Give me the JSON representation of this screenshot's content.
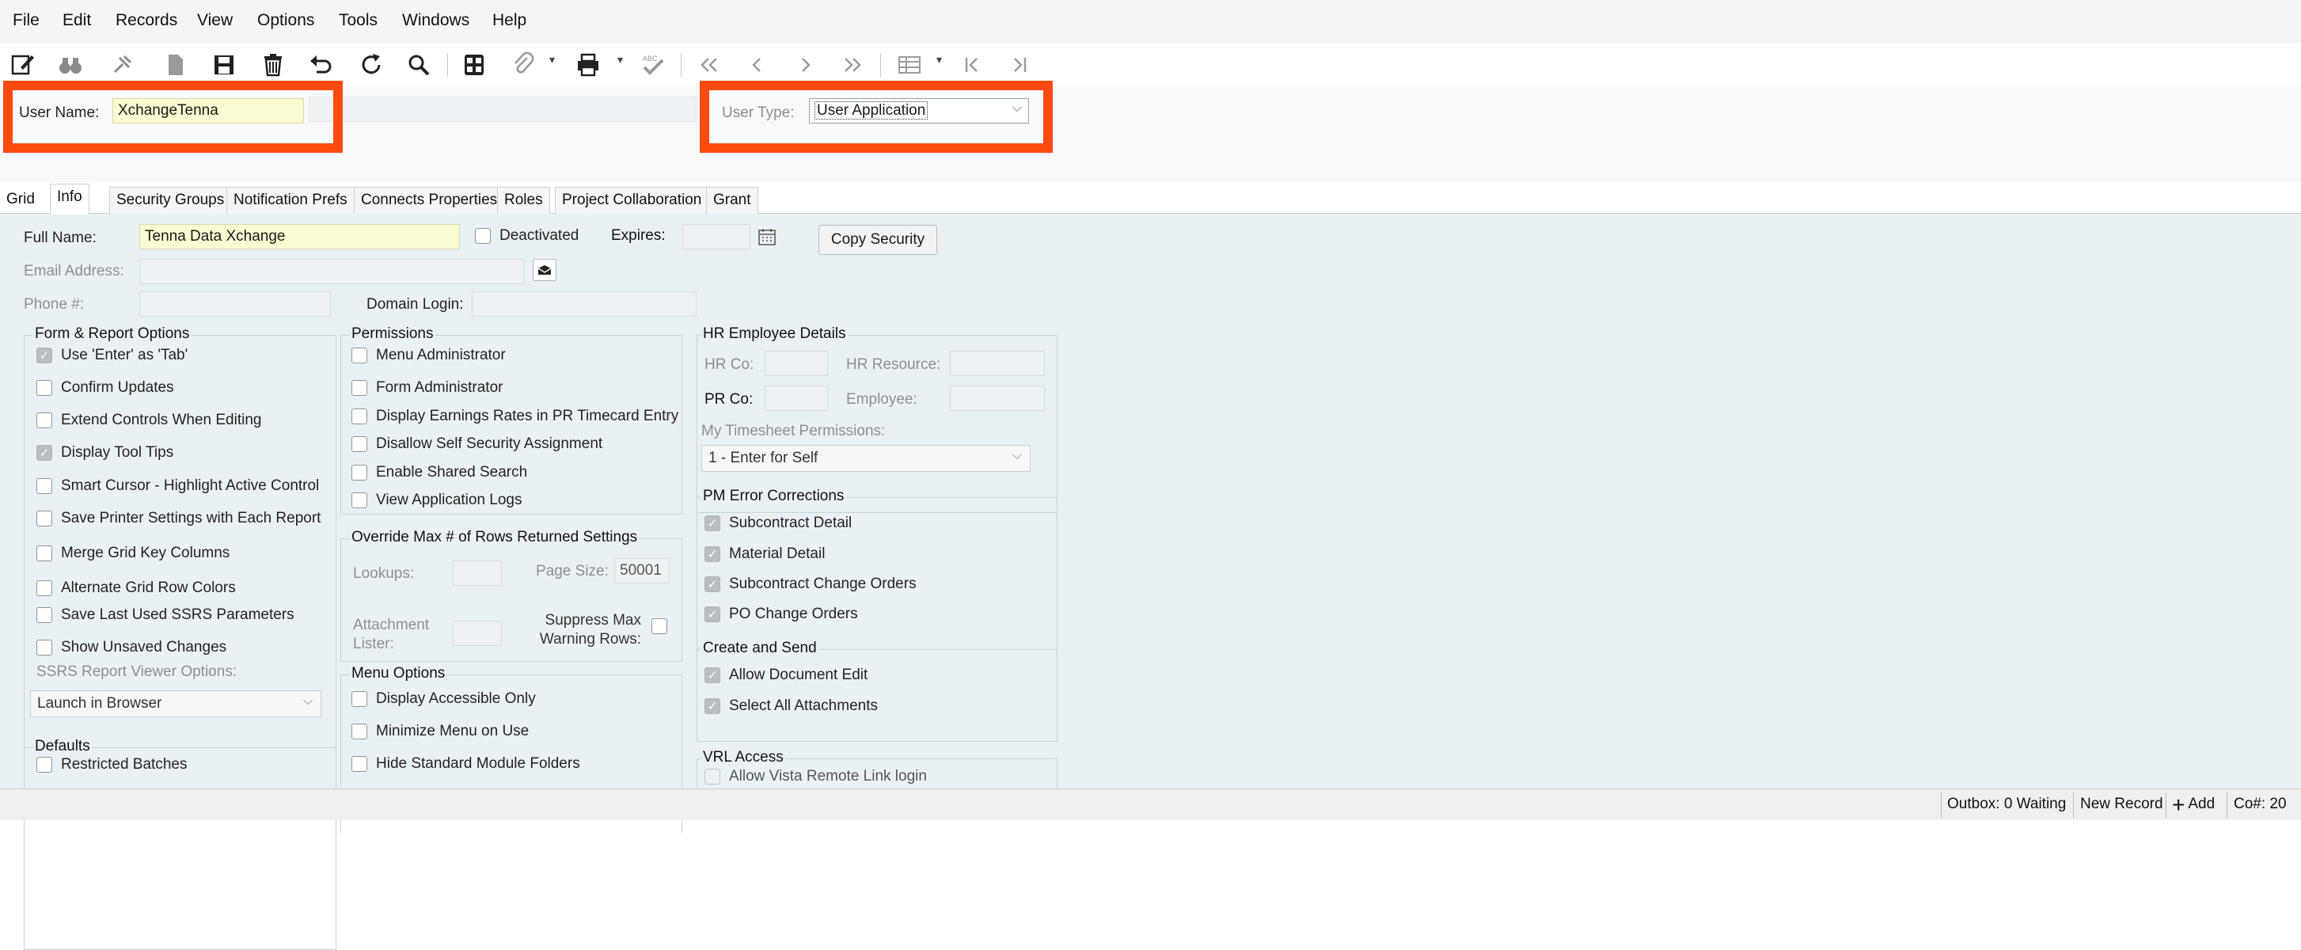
{
  "menu": [
    "File",
    "Edit",
    "Records",
    "View",
    "Options",
    "Tools",
    "Windows",
    "Help"
  ],
  "toolbar": {
    "icons": [
      "edit-icon",
      "binoculars-icon",
      "pin-icon",
      "document-icon",
      "save-icon",
      "delete-icon",
      "undo-icon",
      "refresh-icon",
      "search-icon",
      "calculator-icon",
      "attachment-icon",
      "printer-icon",
      "spellcheck-icon",
      "first-record-icon",
      "previous-record-icon",
      "next-record-icon",
      "last-record-icon",
      "grid-view-icon",
      "go-first-icon",
      "go-last-icon"
    ]
  },
  "header": {
    "user_name_label": "User Name:",
    "user_name_value": "XchangeTenna",
    "user_type_label": "User Type:",
    "user_type_value": "User Application",
    "highlight_color": "#ff4a12"
  },
  "tabs": [
    "Grid",
    "Info",
    "Security Groups",
    "Notification Prefs",
    "Connects Properties",
    "Roles",
    "Project Collaboration",
    "Grant"
  ],
  "active_tab": "Info",
  "info": {
    "full_name_label": "Full Name:",
    "full_name_value": "Tenna Data Xchange",
    "deactivated_label": "Deactivated",
    "expires_label": "Expires:",
    "copy_security_label": "Copy Security",
    "email_label": "Email Address:",
    "phone_label": "Phone #:",
    "domain_login_label": "Domain Login:"
  },
  "form_report_options": {
    "title": "Form & Report Options",
    "items": [
      {
        "label": "Use 'Enter' as 'Tab'",
        "state": "checked-disabled"
      },
      {
        "label": "Confirm Updates",
        "state": "unchecked"
      },
      {
        "label": "Extend Controls When Editing",
        "state": "unchecked"
      },
      {
        "label": "Display Tool Tips",
        "state": "checked-disabled"
      },
      {
        "label": "Smart Cursor - Highlight Active Control",
        "state": "unchecked"
      },
      {
        "label": "Save Printer Settings with Each Report",
        "state": "unchecked"
      },
      {
        "label": "Merge Grid Key Columns",
        "state": "unchecked"
      },
      {
        "label": "Alternate Grid Row Colors",
        "state": "unchecked"
      },
      {
        "label": "Save Last Used SSRS Parameters",
        "state": "unchecked"
      },
      {
        "label": "Show Unsaved Changes",
        "state": "unchecked"
      }
    ],
    "ssrs_label": "SSRS Report Viewer Options:",
    "ssrs_value": "Launch in Browser"
  },
  "defaults": {
    "title": "Defaults",
    "items": [
      {
        "label": "Restricted Batches",
        "state": "unchecked"
      }
    ]
  },
  "permissions": {
    "title": "Permissions",
    "items": [
      {
        "label": "Menu Administrator",
        "state": "unchecked"
      },
      {
        "label": "Form Administrator",
        "state": "unchecked"
      },
      {
        "label": "Display Earnings Rates in PR Timecard Entry",
        "state": "unchecked"
      },
      {
        "label": "Disallow Self Security Assignment",
        "state": "unchecked"
      },
      {
        "label": "Enable Shared Search",
        "state": "unchecked"
      },
      {
        "label": "View Application Logs",
        "state": "unchecked"
      }
    ]
  },
  "override_rows": {
    "title": "Override Max # of Rows Returned Settings",
    "lookups_label": "Lookups:",
    "page_size_label": "Page Size:",
    "page_size_value": "50001",
    "attachment_lister_label": "Attachment Lister:",
    "suppress_label": "Suppress Max Warning Rows:"
  },
  "menu_options": {
    "title": "Menu Options",
    "items": [
      {
        "label": "Display Accessible Only",
        "state": "unchecked"
      },
      {
        "label": "Minimize Menu on Use",
        "state": "unchecked"
      },
      {
        "label": "Hide Standard Module Folders",
        "state": "unchecked"
      }
    ]
  },
  "hr_details": {
    "title": "HR  Employee Details",
    "hr_co_label": "HR Co:",
    "hr_resource_label": "HR Resource:",
    "pr_co_label": "PR Co:",
    "employee_label": "Employee:",
    "timesheet_label": "My Timesheet Permissions:",
    "timesheet_value": "1 - Enter for Self"
  },
  "pm_error": {
    "title": "PM Error Corrections",
    "items": [
      {
        "label": "Subcontract Detail",
        "state": "checked-disabled"
      },
      {
        "label": "Material Detail",
        "state": "checked-disabled"
      },
      {
        "label": "Subcontract Change Orders",
        "state": "checked-disabled"
      },
      {
        "label": "PO Change Orders",
        "state": "checked-disabled"
      }
    ]
  },
  "create_send": {
    "title": "Create and Send",
    "items": [
      {
        "label": "Allow Document Edit",
        "state": "checked-disabled"
      },
      {
        "label": "Select All Attachments",
        "state": "checked-disabled"
      }
    ]
  },
  "vrl": {
    "title": "VRL Access",
    "items": [
      {
        "label": "Allow Vista Remote Link login",
        "state": "unchecked-disabled"
      }
    ]
  },
  "status": {
    "outbox": "Outbox: 0 Waiting",
    "new_record": "New Record",
    "add": "Add",
    "co": "Co#: 20"
  }
}
